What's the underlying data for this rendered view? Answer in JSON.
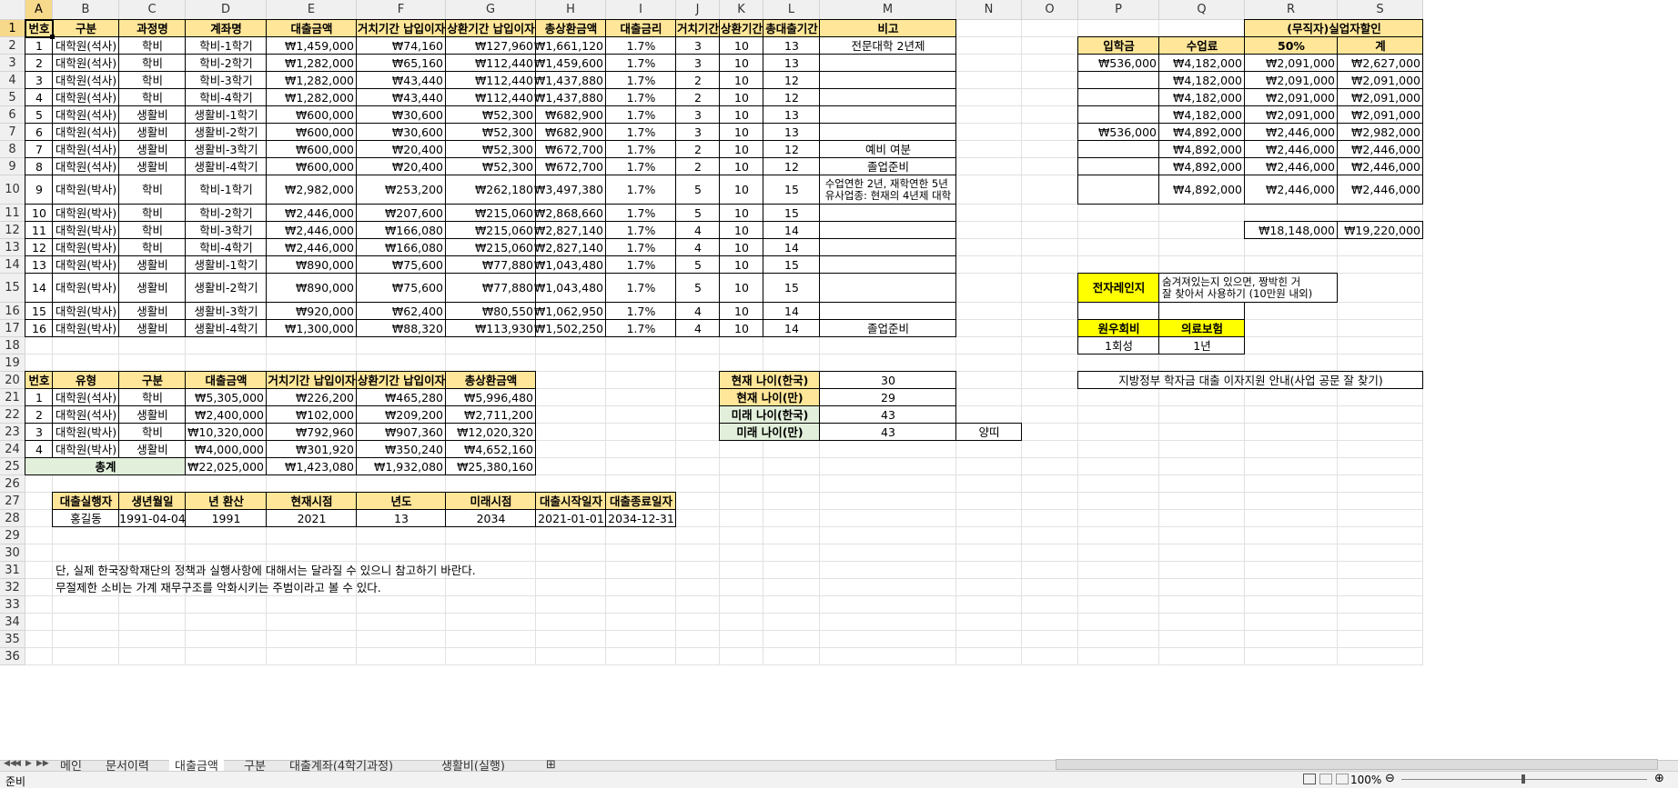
{
  "columns": [
    "A",
    "B",
    "C",
    "D",
    "E",
    "F",
    "G",
    "H",
    "I",
    "J",
    "K",
    "L",
    "M",
    "N",
    "O",
    "P",
    "Q",
    "R",
    "S"
  ],
  "rows": [
    "1",
    "2",
    "3",
    "4",
    "5",
    "6",
    "7",
    "8",
    "9",
    "10",
    "11",
    "12",
    "13",
    "14",
    "15",
    "16",
    "17",
    "18",
    "19",
    "20",
    "21",
    "22",
    "23",
    "24",
    "25",
    "26",
    "27",
    "28",
    "29",
    "30",
    "31",
    "32",
    "33",
    "34",
    "35",
    "36"
  ],
  "active_cell": "A1",
  "colors": {
    "header_fill": "#ffe699",
    "accent_fill": "#ffff00",
    "green_fill": "#e2efda"
  },
  "cells": {
    "A1": "번호",
    "B1": "구분",
    "C1": "과정명",
    "D1": "계좌명",
    "E1": "대출금액",
    "F1": "거치기간 납입이자",
    "G1": "상환기간 납입이자",
    "H1": "총상환금액",
    "I1": "대출금리",
    "J1": "거치기간",
    "K1": "상환기간",
    "L1": "총대출기간",
    "M1": "비고",
    "R1": "(무직자)실업자할인",
    "A2": "1",
    "B2": "대학원(석사)",
    "C2": "학비",
    "D2": "학비-1학기",
    "E2": "₩1,459,000",
    "F2": "₩74,160",
    "G2": "₩127,960",
    "H2": "₩1,661,120",
    "I2": "1.7%",
    "J2": "3",
    "K2": "10",
    "L2": "13",
    "M2": "전문대학 2년제",
    "P2": "입학금",
    "Q2": "수업료",
    "R2": "50%",
    "S2": "계",
    "A3": "2",
    "B3": "대학원(석사)",
    "C3": "학비",
    "D3": "학비-2학기",
    "E3": "₩1,282,000",
    "F3": "₩65,160",
    "G3": "₩112,440",
    "H3": "₩1,459,600",
    "I3": "1.7%",
    "J3": "3",
    "K3": "10",
    "L3": "13",
    "P3": "₩536,000",
    "Q3": "₩4,182,000",
    "R3": "₩2,091,000",
    "S3": "₩2,627,000",
    "A4": "3",
    "B4": "대학원(석사)",
    "C4": "학비",
    "D4": "학비-3학기",
    "E4": "₩1,282,000",
    "F4": "₩43,440",
    "G4": "₩112,440",
    "H4": "₩1,437,880",
    "I4": "1.7%",
    "J4": "2",
    "K4": "10",
    "L4": "12",
    "Q4": "₩4,182,000",
    "R4": "₩2,091,000",
    "S4": "₩2,091,000",
    "A5": "4",
    "B5": "대학원(석사)",
    "C5": "학비",
    "D5": "학비-4학기",
    "E5": "₩1,282,000",
    "F5": "₩43,440",
    "G5": "₩112,440",
    "H5": "₩1,437,880",
    "I5": "1.7%",
    "J5": "2",
    "K5": "10",
    "L5": "12",
    "Q5": "₩4,182,000",
    "R5": "₩2,091,000",
    "S5": "₩2,091,000",
    "A6": "5",
    "B6": "대학원(석사)",
    "C6": "생활비",
    "D6": "생활비-1학기",
    "E6": "₩600,000",
    "F6": "₩30,600",
    "G6": "₩52,300",
    "H6": "₩682,900",
    "I6": "1.7%",
    "J6": "3",
    "K6": "10",
    "L6": "13",
    "Q6": "₩4,182,000",
    "R6": "₩2,091,000",
    "S6": "₩2,091,000",
    "A7": "6",
    "B7": "대학원(석사)",
    "C7": "생활비",
    "D7": "생활비-2학기",
    "E7": "₩600,000",
    "F7": "₩30,600",
    "G7": "₩52,300",
    "H7": "₩682,900",
    "I7": "1.7%",
    "J7": "3",
    "K7": "10",
    "L7": "13",
    "P7": "₩536,000",
    "Q7": "₩4,892,000",
    "R7": "₩2,446,000",
    "S7": "₩2,982,000",
    "A8": "7",
    "B8": "대학원(석사)",
    "C8": "생활비",
    "D8": "생활비-3학기",
    "E8": "₩600,000",
    "F8": "₩20,400",
    "G8": "₩52,300",
    "H8": "₩672,700",
    "I8": "1.7%",
    "J8": "2",
    "K8": "10",
    "L8": "12",
    "M8": "예비 여분",
    "Q8": "₩4,892,000",
    "R8": "₩2,446,000",
    "S8": "₩2,446,000",
    "A9": "8",
    "B9": "대학원(석사)",
    "C9": "생활비",
    "D9": "생활비-4학기",
    "E9": "₩600,000",
    "F9": "₩20,400",
    "G9": "₩52,300",
    "H9": "₩672,700",
    "I9": "1.7%",
    "J9": "2",
    "K9": "10",
    "L9": "12",
    "M9": "졸업준비",
    "Q9": "₩4,892,000",
    "R9": "₩2,446,000",
    "S9": "₩2,446,000",
    "A10": "9",
    "B10": "대학원(박사)",
    "C10": "학비",
    "D10": "학비-1학기",
    "E10": "₩2,982,000",
    "F10": "₩253,200",
    "G10": "₩262,180",
    "H10": "₩3,497,380",
    "I10": "1.7%",
    "J10": "5",
    "K10": "10",
    "L10": "15",
    "M10": "수업연한 2년, 재학연한 5년\n유사업종: 현재의 4년제 대학",
    "Q10": "₩4,892,000",
    "R10": "₩2,446,000",
    "S10": "₩2,446,000",
    "A11": "10",
    "B11": "대학원(박사)",
    "C11": "학비",
    "D11": "학비-2학기",
    "E11": "₩2,446,000",
    "F11": "₩207,600",
    "G11": "₩215,060",
    "H11": "₩2,868,660",
    "I11": "1.7%",
    "J11": "5",
    "K11": "10",
    "L11": "15",
    "A12": "11",
    "B12": "대학원(박사)",
    "C12": "학비",
    "D12": "학비-3학기",
    "E12": "₩2,446,000",
    "F12": "₩166,080",
    "G12": "₩215,060",
    "H12": "₩2,827,140",
    "I12": "1.7%",
    "J12": "4",
    "K12": "10",
    "L12": "14",
    "R12": "₩18,148,000",
    "S12": "₩19,220,000",
    "A13": "12",
    "B13": "대학원(박사)",
    "C13": "학비",
    "D13": "학비-4학기",
    "E13": "₩2,446,000",
    "F13": "₩166,080",
    "G13": "₩215,060",
    "H13": "₩2,827,140",
    "I13": "1.7%",
    "J13": "4",
    "K13": "10",
    "L13": "14",
    "A14": "13",
    "B14": "대학원(박사)",
    "C14": "생활비",
    "D14": "생활비-1학기",
    "E14": "₩890,000",
    "F14": "₩75,600",
    "G14": "₩77,880",
    "H14": "₩1,043,480",
    "I14": "1.7%",
    "J14": "5",
    "K14": "10",
    "L14": "15",
    "A15": "14",
    "B15": "대학원(박사)",
    "C15": "생활비",
    "D15": "생활비-2학기",
    "E15": "₩890,000",
    "F15": "₩75,600",
    "G15": "₩77,880",
    "H15": "₩1,043,480",
    "I15": "1.7%",
    "J15": "5",
    "K15": "10",
    "L15": "15",
    "P15": "전자레인지",
    "Q15": "숨겨져있는지 있으면, 짱박힌 거\n잘 찾아서 사용하기 (10만원 내외)",
    "A16": "15",
    "B16": "대학원(박사)",
    "C16": "생활비",
    "D16": "생활비-3학기",
    "E16": "₩920,000",
    "F16": "₩62,400",
    "G16": "₩80,550",
    "H16": "₩1,062,950",
    "I16": "1.7%",
    "J16": "4",
    "K16": "10",
    "L16": "14",
    "A17": "16",
    "B17": "대학원(박사)",
    "C17": "생활비",
    "D17": "생활비-4학기",
    "E17": "₩1,300,000",
    "F17": "₩88,320",
    "G17": "₩113,930",
    "H17": "₩1,502,250",
    "I17": "1.7%",
    "J17": "4",
    "K17": "10",
    "L17": "14",
    "M17": "졸업준비",
    "P17": "원우회비",
    "Q17": "의료보험",
    "P18": "1회성",
    "Q18": "1년",
    "A20": "번호",
    "B20": "유형",
    "C20": "구분",
    "D20": "대출금액",
    "E20": "거치기간 납입이자",
    "F20": "상환기간 납입이자",
    "G20": "총상환금액",
    "K20": "현재 나이(한국)",
    "M20": "30",
    "P20": "지방정부 학자금 대출 이자지원 안내(사업 공문 잘 찾기)",
    "A21": "1",
    "B21": "대학원(석사)",
    "C21": "학비",
    "D21": "₩5,305,000",
    "E21": "₩226,200",
    "F21": "₩465,280",
    "G21": "₩5,996,480",
    "K21": "현재 나이(만)",
    "M21": "29",
    "A22": "2",
    "B22": "대학원(석사)",
    "C22": "생활비",
    "D22": "₩2,400,000",
    "E22": "₩102,000",
    "F22": "₩209,200",
    "G22": "₩2,711,200",
    "K22": "미래 나이(한국)",
    "M22": "43",
    "A23": "3",
    "B23": "대학원(박사)",
    "C23": "학비",
    "D23": "₩10,320,000",
    "E23": "₩792,960",
    "F23": "₩907,360",
    "G23": "₩12,020,320",
    "K23": "미래 나이(만)",
    "M23": "43",
    "N23": "양띠",
    "A24": "4",
    "B24": "대학원(박사)",
    "C24": "생활비",
    "D24": "₩4,000,000",
    "E24": "₩301,920",
    "F24": "₩350,240",
    "G24": "₩4,652,160",
    "A25": "총계",
    "D25": "₩22,025,000",
    "E25": "₩1,423,080",
    "F25": "₩1,932,080",
    "G25": "₩25,380,160",
    "B27": "대출실행자",
    "C27": "생년월일",
    "D27": "년 환산",
    "E27": "현재시점",
    "F27": "년도",
    "G27": "미래시점",
    "H27": "대출시작일자",
    "I27": "대출종료일자",
    "B28": "홍길동",
    "C28": "1991-04-04",
    "D28": "1991",
    "E28": "2021",
    "F28": "13",
    "G28": "2034",
    "H28": "2021-01-01",
    "I28": "2034-12-31",
    "B31": "단, 실제 한국장학재단의 정책과 실행사항에 대해서는 달라질 수 있으니 참고하기 바란다.",
    "B32": "무절제한 소비는 가계 재무구조를 악화시키는 주범이라고 볼 수 있다."
  },
  "sheet_tabs": [
    "메인",
    "문서이력",
    "대출금액",
    "구분",
    "대출계좌(4학기과정)",
    "생활비(실행)"
  ],
  "active_tab": "대출금액",
  "status": {
    "ready": "준비",
    "zoom": "100%"
  }
}
